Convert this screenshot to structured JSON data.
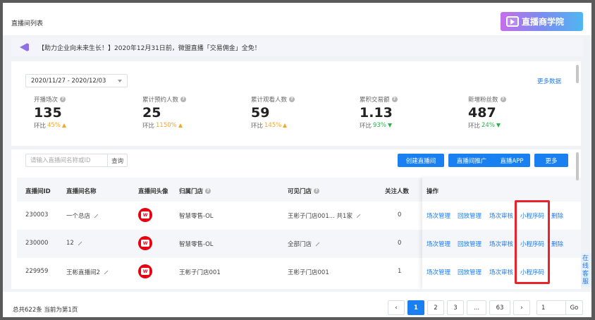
{
  "header": {
    "page_title": "直播间列表",
    "academy_label": "直播商学院"
  },
  "notice": {
    "text": "【助力企业向未来生长！】2020年12月31日前，微盟直播「交易佣金」全免！"
  },
  "stats": {
    "date_range": "2020/11/27 - 2020/12/03",
    "more_data": "更多数据",
    "ratio_label": "环比",
    "items": [
      {
        "label": "开播场次",
        "value": "135",
        "ratio": "45%",
        "trend": "up"
      },
      {
        "label": "累计预约人数",
        "value": "25",
        "ratio": "1150%",
        "trend": "up"
      },
      {
        "label": "累计观看人数",
        "value": "59",
        "ratio": "145%",
        "trend": "up"
      },
      {
        "label": "累积交易额",
        "value": "1.13",
        "ratio": "93%",
        "trend": "down"
      },
      {
        "label": "新增粉丝数",
        "value": "487",
        "ratio": "24%",
        "trend": "down"
      }
    ]
  },
  "toolbar": {
    "search_placeholder": "请输入直播间名称或ID",
    "search_button": "查询",
    "create_button": "创建直播间",
    "promote_button": "直播间推广",
    "app_button": "直播APP",
    "more_button": "更多"
  },
  "table": {
    "headers": {
      "id": "直播间ID",
      "name": "直播间名称",
      "avatar": "直播间头像",
      "store": "归属门店",
      "visible": "可见门店",
      "followers": "关注人数",
      "ops": "操作"
    },
    "rows": [
      {
        "id": "230003",
        "name": "一个总店",
        "store": "智慧零售-OL",
        "visible": "王彬子门店001... 共1家",
        "followers": "0"
      },
      {
        "id": "230000",
        "name": "12",
        "store": "智慧零售-OL",
        "visible": "全部门店",
        "followers": "0"
      },
      {
        "id": "229959",
        "name": "王彬直播间2",
        "store": "王彬子门店001",
        "visible": "王彬子门店001",
        "followers": "1"
      }
    ],
    "actions": {
      "session": "场次管理",
      "playback": "回放管理",
      "review": "场次审核",
      "mini": "小程序码",
      "delete": "删除"
    }
  },
  "side_tab": "在线客服",
  "footer": {
    "total_text": "总共622条 当前为第1页",
    "pages": [
      "1",
      "2",
      "3",
      "...",
      "63"
    ],
    "prev": "‹",
    "next": "›",
    "page_input": "1",
    "go": "Go"
  },
  "colors": {
    "primary": "#1a7ff0",
    "highlight": "#e8232a",
    "up": "#f5a623",
    "down": "#2bb24c"
  }
}
